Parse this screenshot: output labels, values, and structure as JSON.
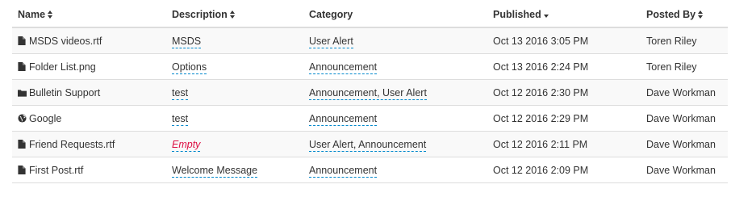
{
  "headers": {
    "name": "Name",
    "description": "Description",
    "category": "Category",
    "published": "Published",
    "posted_by": "Posted By"
  },
  "rows": [
    {
      "icon": "file-icon",
      "name": "MSDS videos.rtf",
      "description": "MSDS",
      "category": "User Alert",
      "published": "Oct 13 2016 3:05 PM",
      "posted_by": "Toren Riley"
    },
    {
      "icon": "file-icon",
      "name": "Folder List.png",
      "description": "Options",
      "category": "Announcement",
      "published": "Oct 13 2016 2:24 PM",
      "posted_by": "Toren Riley"
    },
    {
      "icon": "folder-icon",
      "name": "Bulletin Support",
      "description": "test",
      "category": "Announcement, User Alert",
      "published": "Oct 12 2016 2:30 PM",
      "posted_by": "Dave Workman"
    },
    {
      "icon": "globe-icon",
      "name": "Google",
      "description": "test",
      "category": "Announcement",
      "published": "Oct 12 2016 2:29 PM",
      "posted_by": "Dave Workman"
    },
    {
      "icon": "file-icon",
      "name": "Friend Requests.rtf",
      "description": "Empty",
      "category": "User Alert, Announcement",
      "published": "Oct 12 2016 2:11 PM",
      "posted_by": "Dave Workman"
    },
    {
      "icon": "file-icon",
      "name": "First Post.rtf",
      "description": "Welcome Message",
      "category": "Announcement",
      "published": "Oct 12 2016 2:09 PM",
      "posted_by": "Dave Workman"
    }
  ]
}
